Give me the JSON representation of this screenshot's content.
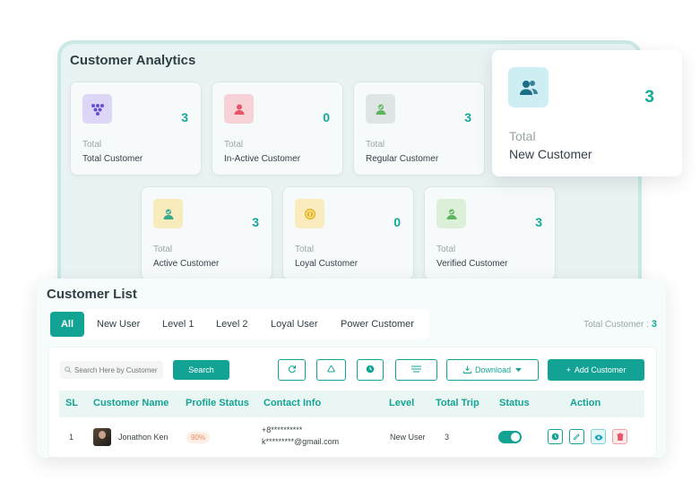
{
  "analytics": {
    "title": "Customer Analytics",
    "cards": [
      {
        "total_label": "Total",
        "label": "Total Customer",
        "value": "3",
        "icon": "grid-dots-icon",
        "icon_bg": "#ded6f6",
        "icon_color": "#6b4fd1"
      },
      {
        "total_label": "Total",
        "label": "In-Active Customer",
        "value": "0",
        "icon": "user-icon",
        "icon_bg": "#f6d2d6",
        "icon_color": "#e4566a"
      },
      {
        "total_label": "Total",
        "label": "Regular Customer",
        "value": "3",
        "icon": "user-check-icon",
        "icon_bg": "#dfe5e4",
        "icon_color": "#5fb55f"
      },
      {
        "total_label": "Total",
        "label": "Active Customer",
        "value": "3",
        "icon": "user-check-icon",
        "icon_bg": "#f8ecbd",
        "icon_color": "#3aa88b"
      },
      {
        "total_label": "Total",
        "label": "Loyal Customer",
        "value": "0",
        "icon": "coin-icon",
        "icon_bg": "#faecbe",
        "icon_color": "#e6b421"
      },
      {
        "total_label": "Total",
        "label": "Verified Customer",
        "value": "3",
        "icon": "user-verified-icon",
        "icon_bg": "#dcefd8",
        "icon_color": "#5fb55f"
      }
    ],
    "new_customer": {
      "total_label": "Total",
      "label": "New Customer",
      "value": "3",
      "icon": "users-icon"
    }
  },
  "customer_list": {
    "title": "Customer List",
    "tabs": [
      "All",
      "New User",
      "Level 1",
      "Level 2",
      "Loyal User",
      "Power Customer"
    ],
    "active_tab": "All",
    "total_label": "Total Customer :",
    "total_value": "3",
    "search": {
      "placeholder": "Search Here by Customer",
      "button": "Search"
    },
    "download_label": "Download",
    "add_label": "Add Customer",
    "columns": [
      "SL",
      "Customer Name",
      "Profile Status",
      "Contact Info",
      "Level",
      "Total Trip",
      "Status",
      "Action"
    ],
    "rows": [
      {
        "sl": "1",
        "name": "Jonathon Ken",
        "profile": "90%",
        "phone": "+8**********",
        "email": "k*********@gmail.com",
        "level": "New User",
        "trips": "3",
        "status_on": true
      }
    ]
  },
  "colors": {
    "accent": "#13a394",
    "value_text": "#14a89a"
  }
}
